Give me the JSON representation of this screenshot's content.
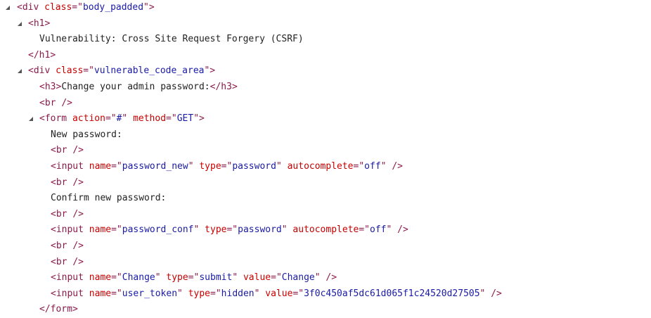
{
  "lines": [
    {
      "indent": 24,
      "twisty": 7,
      "parts": [
        [
          "punct",
          "<"
        ],
        [
          "tag",
          "div"
        ],
        [
          "txt",
          " "
        ],
        [
          "attr",
          "class"
        ],
        [
          "punct",
          "=\""
        ],
        [
          "val",
          "body_padded"
        ],
        [
          "punct",
          "\">"
        ]
      ]
    },
    {
      "indent": 40,
      "twisty": 24,
      "parts": [
        [
          "punct",
          "<"
        ],
        [
          "tag",
          "h1"
        ],
        [
          "punct",
          ">"
        ]
      ]
    },
    {
      "indent": 56,
      "twisty": null,
      "parts": [
        [
          "txt",
          "Vulnerability: Cross Site Request Forgery (CSRF)"
        ]
      ]
    },
    {
      "indent": 40,
      "twisty": null,
      "parts": [
        [
          "punct",
          "</"
        ],
        [
          "tag",
          "h1"
        ],
        [
          "punct",
          ">"
        ]
      ]
    },
    {
      "indent": 40,
      "twisty": 24,
      "parts": [
        [
          "punct",
          "<"
        ],
        [
          "tag",
          "div"
        ],
        [
          "txt",
          " "
        ],
        [
          "attr",
          "class"
        ],
        [
          "punct",
          "=\""
        ],
        [
          "val",
          "vulnerable_code_area"
        ],
        [
          "punct",
          "\">"
        ]
      ]
    },
    {
      "indent": 56,
      "twisty": null,
      "parts": [
        [
          "punct",
          "<"
        ],
        [
          "tag",
          "h3"
        ],
        [
          "punct",
          ">"
        ],
        [
          "txt",
          "Change your admin password:"
        ],
        [
          "punct",
          "</"
        ],
        [
          "tag",
          "h3"
        ],
        [
          "punct",
          ">"
        ]
      ]
    },
    {
      "indent": 56,
      "twisty": null,
      "parts": [
        [
          "punct",
          "<"
        ],
        [
          "tag",
          "br"
        ],
        [
          "txt",
          " "
        ],
        [
          "punct",
          "/>"
        ]
      ]
    },
    {
      "indent": 56,
      "twisty": 40,
      "parts": [
        [
          "punct",
          "<"
        ],
        [
          "tag",
          "form"
        ],
        [
          "txt",
          " "
        ],
        [
          "attr",
          "action"
        ],
        [
          "punct",
          "=\""
        ],
        [
          "val",
          "#"
        ],
        [
          "punct",
          "\""
        ],
        [
          "txt",
          " "
        ],
        [
          "attr",
          "method"
        ],
        [
          "punct",
          "=\""
        ],
        [
          "val",
          "GET"
        ],
        [
          "punct",
          "\">"
        ]
      ]
    },
    {
      "indent": 72,
      "twisty": null,
      "parts": [
        [
          "txt",
          "New password:"
        ]
      ]
    },
    {
      "indent": 72,
      "twisty": null,
      "parts": [
        [
          "punct",
          "<"
        ],
        [
          "tag",
          "br"
        ],
        [
          "txt",
          " "
        ],
        [
          "punct",
          "/>"
        ]
      ]
    },
    {
      "indent": 72,
      "twisty": null,
      "parts": [
        [
          "punct",
          "<"
        ],
        [
          "tag",
          "input"
        ],
        [
          "txt",
          " "
        ],
        [
          "attr",
          "name"
        ],
        [
          "punct",
          "=\""
        ],
        [
          "val",
          "password_new"
        ],
        [
          "punct",
          "\""
        ],
        [
          "txt",
          " "
        ],
        [
          "attr",
          "type"
        ],
        [
          "punct",
          "=\""
        ],
        [
          "val",
          "password"
        ],
        [
          "punct",
          "\""
        ],
        [
          "txt",
          " "
        ],
        [
          "attr",
          "autocomplete"
        ],
        [
          "punct",
          "=\""
        ],
        [
          "val",
          "off"
        ],
        [
          "punct",
          "\""
        ],
        [
          "txt",
          " "
        ],
        [
          "punct",
          "/>"
        ]
      ]
    },
    {
      "indent": 72,
      "twisty": null,
      "parts": [
        [
          "punct",
          "<"
        ],
        [
          "tag",
          "br"
        ],
        [
          "txt",
          " "
        ],
        [
          "punct",
          "/>"
        ]
      ]
    },
    {
      "indent": 72,
      "twisty": null,
      "parts": [
        [
          "txt",
          "Confirm new password:"
        ]
      ]
    },
    {
      "indent": 72,
      "twisty": null,
      "parts": [
        [
          "punct",
          "<"
        ],
        [
          "tag",
          "br"
        ],
        [
          "txt",
          " "
        ],
        [
          "punct",
          "/>"
        ]
      ]
    },
    {
      "indent": 72,
      "twisty": null,
      "parts": [
        [
          "punct",
          "<"
        ],
        [
          "tag",
          "input"
        ],
        [
          "txt",
          " "
        ],
        [
          "attr",
          "name"
        ],
        [
          "punct",
          "=\""
        ],
        [
          "val",
          "password_conf"
        ],
        [
          "punct",
          "\""
        ],
        [
          "txt",
          " "
        ],
        [
          "attr",
          "type"
        ],
        [
          "punct",
          "=\""
        ],
        [
          "val",
          "password"
        ],
        [
          "punct",
          "\""
        ],
        [
          "txt",
          " "
        ],
        [
          "attr",
          "autocomplete"
        ],
        [
          "punct",
          "=\""
        ],
        [
          "val",
          "off"
        ],
        [
          "punct",
          "\""
        ],
        [
          "txt",
          " "
        ],
        [
          "punct",
          "/>"
        ]
      ]
    },
    {
      "indent": 72,
      "twisty": null,
      "parts": [
        [
          "punct",
          "<"
        ],
        [
          "tag",
          "br"
        ],
        [
          "txt",
          " "
        ],
        [
          "punct",
          "/>"
        ]
      ]
    },
    {
      "indent": 72,
      "twisty": null,
      "parts": [
        [
          "punct",
          "<"
        ],
        [
          "tag",
          "br"
        ],
        [
          "txt",
          " "
        ],
        [
          "punct",
          "/>"
        ]
      ]
    },
    {
      "indent": 72,
      "twisty": null,
      "parts": [
        [
          "punct",
          "<"
        ],
        [
          "tag",
          "input"
        ],
        [
          "txt",
          " "
        ],
        [
          "attr",
          "name"
        ],
        [
          "punct",
          "=\""
        ],
        [
          "val",
          "Change"
        ],
        [
          "punct",
          "\""
        ],
        [
          "txt",
          " "
        ],
        [
          "attr",
          "type"
        ],
        [
          "punct",
          "=\""
        ],
        [
          "val",
          "submit"
        ],
        [
          "punct",
          "\""
        ],
        [
          "txt",
          " "
        ],
        [
          "attr",
          "value"
        ],
        [
          "punct",
          "=\""
        ],
        [
          "val",
          "Change"
        ],
        [
          "punct",
          "\""
        ],
        [
          "txt",
          " "
        ],
        [
          "punct",
          "/>"
        ]
      ]
    },
    {
      "indent": 72,
      "twisty": null,
      "parts": [
        [
          "punct",
          "<"
        ],
        [
          "tag",
          "input"
        ],
        [
          "txt",
          " "
        ],
        [
          "attr",
          "name"
        ],
        [
          "punct",
          "=\""
        ],
        [
          "val",
          "user_token"
        ],
        [
          "punct",
          "\""
        ],
        [
          "txt",
          " "
        ],
        [
          "attr",
          "type"
        ],
        [
          "punct",
          "=\""
        ],
        [
          "val",
          "hidden"
        ],
        [
          "punct",
          "\""
        ],
        [
          "txt",
          " "
        ],
        [
          "attr",
          "value"
        ],
        [
          "punct",
          "=\""
        ],
        [
          "val",
          "3f0c450af5dc61d065f1c24520d27505"
        ],
        [
          "punct",
          "\""
        ],
        [
          "txt",
          " "
        ],
        [
          "punct",
          "/>"
        ]
      ]
    },
    {
      "indent": 56,
      "twisty": null,
      "parts": [
        [
          "punct",
          "</"
        ],
        [
          "tag",
          "form"
        ],
        [
          "punct",
          ">"
        ]
      ]
    }
  ]
}
